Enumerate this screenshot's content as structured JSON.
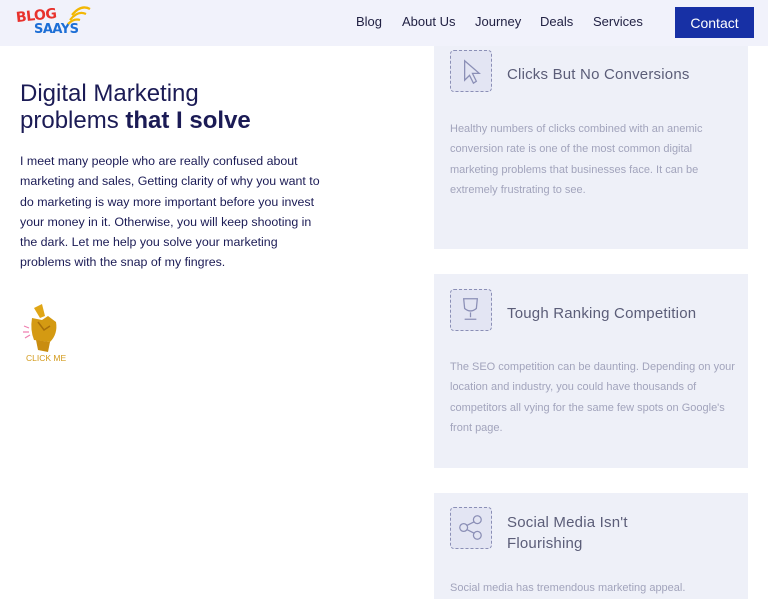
{
  "logo": {
    "line1": "BLOG",
    "line2": "SAAYS"
  },
  "nav": {
    "blog": "Blog",
    "about": "About Us",
    "journey": "Journey",
    "deals": "Deals",
    "services": "Services",
    "contact": "Contact"
  },
  "hero": {
    "title_line1": "Digital Marketing",
    "title_line2_plain": "problems",
    "title_line2_bold": "that I solve",
    "intro": "I meet many people who are really confused about marketing and sales, Getting clarity of why you want to do marketing is way more important before you invest your money in it. Otherwise, you will keep shooting in the dark. Let me help you solve your marketing problems with the snap of my fingres.",
    "cta": "CLICK ME"
  },
  "cards": [
    {
      "title": "Clicks But No Conversions",
      "icon": "cursor-click-icon",
      "text": "Healthy numbers of clicks combined with an anemic conversion rate is one of the most common digital marketing problems that businesses face. It can be extremely frustrating to see."
    },
    {
      "title": "Tough Ranking Competition",
      "icon": "trophy-icon",
      "text": "The SEO competition can be daunting. Depending on your location and industry, you could have thousands of competitors all vying for the same few spots on Google's front page."
    },
    {
      "title": "Social Media Isn't Flourishing",
      "icon": "social-icon",
      "text": "Social media has tremendous marketing appeal."
    }
  ]
}
